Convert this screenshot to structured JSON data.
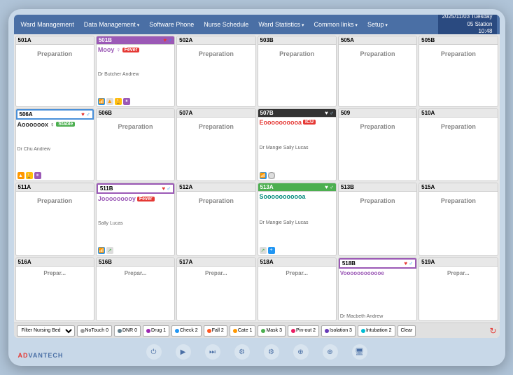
{
  "device": {
    "brand": "AD",
    "brand_red": "VANTECH"
  },
  "topbar": {
    "items": [
      {
        "label": "Ward Management",
        "dropdown": false
      },
      {
        "label": "Data Management",
        "dropdown": true
      },
      {
        "label": "Software Phone",
        "dropdown": false
      },
      {
        "label": "Nurse Schedule",
        "dropdown": false
      },
      {
        "label": "Ward Statistics",
        "dropdown": true
      },
      {
        "label": "Common links",
        "dropdown": true
      },
      {
        "label": "Setup",
        "dropdown": true
      }
    ],
    "station": "05 Station",
    "date": "2025/11/03 Tuesday",
    "time": "10:48"
  },
  "rooms": [
    {
      "id": "r501A",
      "number": "501A",
      "style": "normal",
      "patient": null,
      "content": "preparation"
    },
    {
      "id": "r501B",
      "number": "501B",
      "style": "purple",
      "patient": "Mooy ♀",
      "badge": "Fever",
      "badge_color": "fever",
      "doctor": "Dr Butcher Andrew",
      "icons": [
        "heart",
        "wifi",
        "alert",
        "pause"
      ],
      "content": "patient"
    },
    {
      "id": "r502A",
      "number": "502A",
      "style": "normal",
      "patient": null,
      "content": "preparation"
    },
    {
      "id": "r503B",
      "number": "503B",
      "style": "normal",
      "patient": null,
      "content": "preparation"
    },
    {
      "id": "r505A",
      "number": "505A",
      "style": "normal",
      "patient": null,
      "content": "preparation"
    },
    {
      "id": "r505B",
      "number": "505B",
      "style": "normal",
      "patient": null,
      "content": "preparation"
    },
    {
      "id": "r506A",
      "number": "506A",
      "style": "blue-outline",
      "patient": "Aoooooox ♀",
      "badge": "Stable",
      "badge_color": "stable",
      "doctor": "Dr Chu Andrew",
      "icons": [
        "triangle",
        "trophy",
        "pause"
      ],
      "content": "patient"
    },
    {
      "id": "r506B",
      "number": "506B",
      "style": "normal",
      "patient": null,
      "content": "preparation"
    },
    {
      "id": "r507A",
      "number": "507A",
      "style": "normal",
      "patient": null,
      "content": "preparation"
    },
    {
      "id": "r507B",
      "number": "507B",
      "style": "dark",
      "patient": "Eoooooooooa",
      "badge": "ICU",
      "badge_color": "icu",
      "doctor": "Dr Mangie Sally Lucas",
      "icons": [
        "wifi",
        "circle"
      ],
      "content": "patient"
    },
    {
      "id": "r509",
      "number": "509",
      "style": "normal",
      "patient": null,
      "content": "preparation"
    },
    {
      "id": "r510A",
      "number": "510A",
      "style": "normal",
      "patient": null,
      "content": "preparation"
    },
    {
      "id": "r511A",
      "number": "511A",
      "style": "normal",
      "patient": null,
      "content": "preparation"
    },
    {
      "id": "r511B",
      "number": "511B",
      "style": "purple-outline",
      "patient": "Jooooooooy",
      "badge": "Fever",
      "badge_color": "fever",
      "doctor": "Sally Lucas",
      "icons": [
        "wifi",
        "arrow"
      ],
      "content": "patient"
    },
    {
      "id": "r512A",
      "number": "512A",
      "style": "normal",
      "patient": null,
      "content": "preparation"
    },
    {
      "id": "r513A",
      "number": "513A",
      "style": "green",
      "patient": "Sooooooooooa",
      "badge": null,
      "doctor": "Dr Mangie Sally Lucas",
      "icons": [
        "arrow",
        "plus"
      ],
      "content": "patient"
    },
    {
      "id": "r513B",
      "number": "513B",
      "style": "normal",
      "patient": null,
      "content": "preparation"
    },
    {
      "id": "r515A",
      "number": "515A",
      "style": "normal",
      "patient": null,
      "content": "preparation"
    },
    {
      "id": "r516A",
      "number": "516A",
      "style": "normal",
      "patient": null,
      "content": "partial"
    },
    {
      "id": "r516B",
      "number": "516B",
      "style": "normal",
      "patient": null,
      "content": "partial"
    },
    {
      "id": "r517A",
      "number": "517A",
      "style": "normal",
      "patient": null,
      "content": "partial"
    },
    {
      "id": "r518A",
      "number": "518A",
      "style": "normal",
      "patient": null,
      "content": "partial"
    },
    {
      "id": "r518B",
      "number": "518B",
      "style": "purple-outline",
      "patient": "Voooooooooooe",
      "badge": null,
      "doctor": "Dr Macbeth Andrew",
      "icons": [],
      "content": "patient-partial"
    },
    {
      "id": "r519A",
      "number": "519A",
      "style": "normal",
      "patient": null,
      "content": "partial"
    }
  ],
  "filters": [
    {
      "label": "Filter Nursing Bed",
      "type": "select"
    },
    {
      "label": "NoTouch 0",
      "dot_color": "#9e9e9e"
    },
    {
      "label": "DNR 0",
      "dot_color": "#607d8b"
    },
    {
      "label": "Drug 1",
      "dot_color": "#9c27b0"
    },
    {
      "label": "Check 2",
      "dot_color": "#2196f3"
    },
    {
      "label": "Fall 2",
      "dot_color": "#ff5722"
    },
    {
      "label": "Cate 1",
      "dot_color": "#ff9800"
    },
    {
      "label": "Mask 3",
      "dot_color": "#4caf50"
    },
    {
      "label": "Pin-out 2",
      "dot_color": "#e91e63"
    },
    {
      "label": "Isolation 3",
      "dot_color": "#673ab7"
    },
    {
      "label": "Intubation 2",
      "dot_color": "#00bcd4"
    },
    {
      "label": "Clear",
      "dot_color": null
    }
  ],
  "preparation_text": "Preparation",
  "partial_text": "Preparation"
}
